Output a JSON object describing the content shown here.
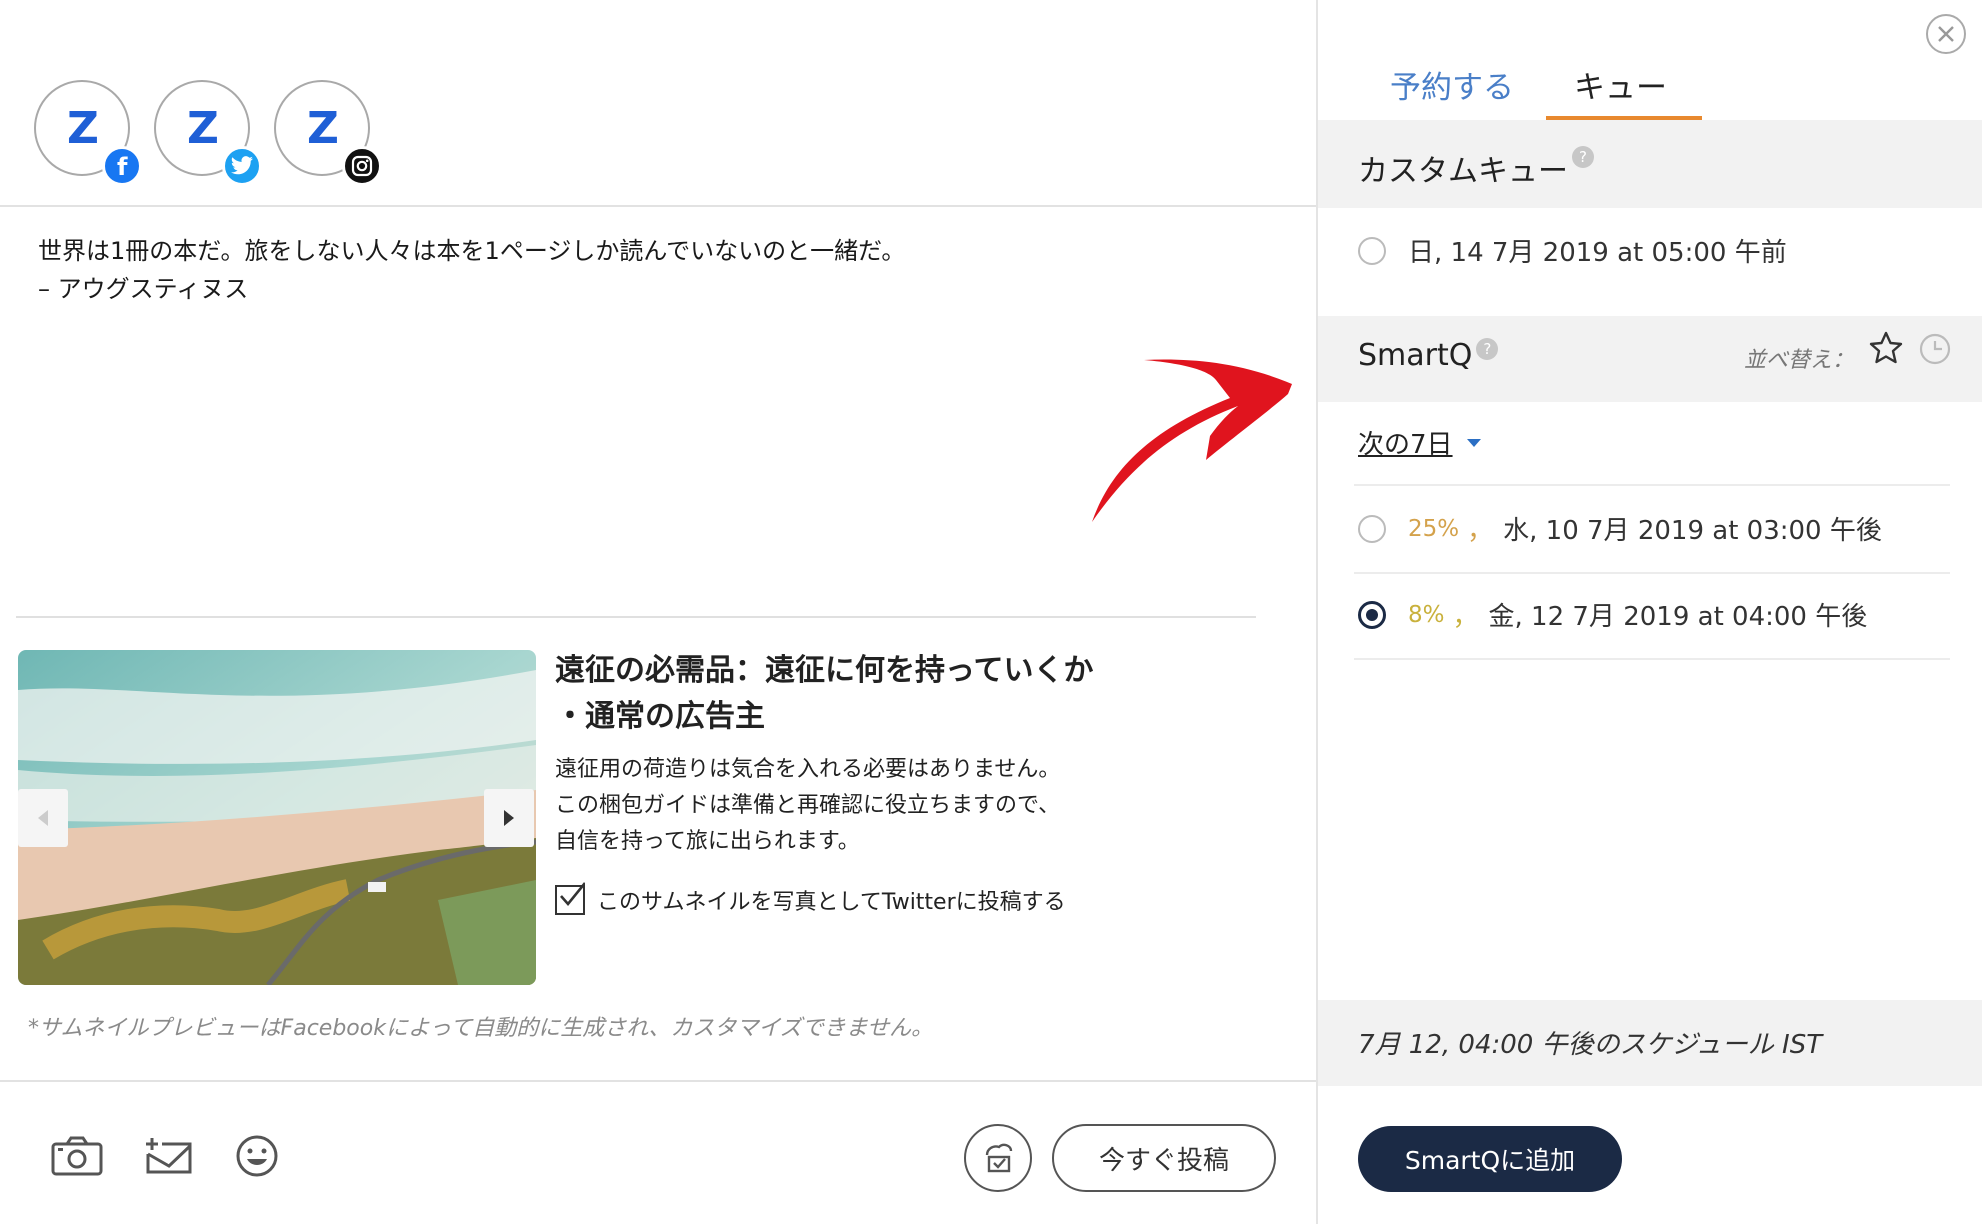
{
  "composer": {
    "profiles": [
      {
        "network": "facebook",
        "logo_letter": "Z"
      },
      {
        "network": "twitter",
        "logo_letter": "Z"
      },
      {
        "network": "instagram",
        "logo_letter": "Z"
      }
    ],
    "post_text": {
      "line1": "世界は1冊の本だ。旅をしない人々は本を1ページしか読んでいないのと一緒だ。",
      "line2": "– アウグスティヌス"
    },
    "link_preview": {
      "title_line1": "遠征の必需品：遠征に何を持っていくか",
      "title_line2": "・通常の広告主",
      "desc_line1": "遠征用の荷造りは気合を入れる必要はありません。",
      "desc_line2": "この梱包ガイドは準備と再確認に役立ちますので、",
      "desc_line3": "自信を持って旅に出られます。",
      "twitter_option": "このサムネイルを写真としてTwitterに投稿する",
      "twitter_option_checked": true
    },
    "footnote": "*サムネイルプレビューはFacebookによって自動的に生成され、カスタマイズできません。",
    "toolbar": {
      "icons": [
        "camera-icon",
        "add-mail-icon",
        "smiley-icon"
      ],
      "draft_icon": "save-draft-icon",
      "post_now_label": "今すぐ投稿"
    }
  },
  "panel": {
    "tabs": [
      {
        "label": "予約する",
        "active": false
      },
      {
        "label": "キュー",
        "active": true
      }
    ],
    "custom_queue": {
      "title": "カスタムキュー",
      "help": "?",
      "slots": [
        {
          "label": "日, 14 7月 2019 at 05:00 午前",
          "selected": false
        }
      ]
    },
    "smartq": {
      "title": "SmartQ",
      "help": "?",
      "sort_label": "並べ替え：",
      "range_label": "次の7日",
      "slots": [
        {
          "percent": "25%",
          "percent_color": "#d4a24c",
          "separator": "，",
          "label": "水, 10 7月 2019 at 03:00 午後",
          "selected": false
        },
        {
          "percent": "8%",
          "percent_color": "#c9b13c",
          "separator": "，",
          "label": "金, 12 7月 2019 at 04:00 午後",
          "selected": true
        }
      ]
    },
    "summary": "7月 12, 04:00 午後のスケジュール IST",
    "add_button": "SmartQに追加"
  },
  "colors": {
    "accent_tab": "#e8892e",
    "primary_button": "#1b2a45",
    "link_blue": "#4a7fc8",
    "annotation_arrow": "#e0141e"
  }
}
